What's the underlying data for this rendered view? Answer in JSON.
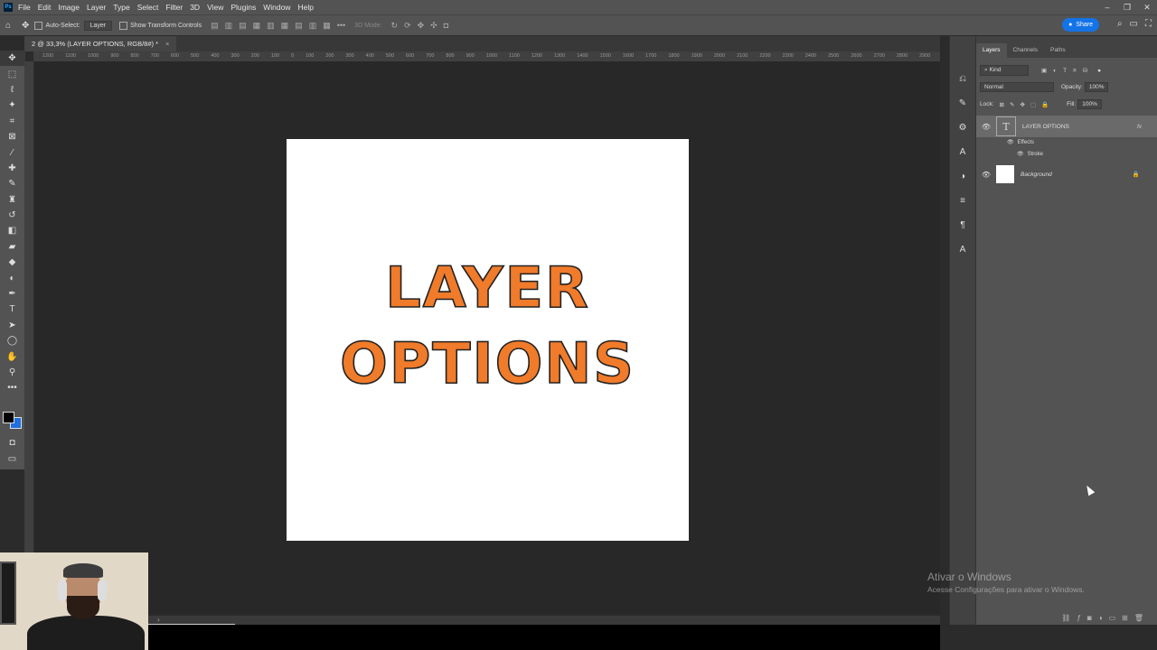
{
  "menubar": {
    "items": [
      "File",
      "Edit",
      "Image",
      "Layer",
      "Type",
      "Select",
      "Filter",
      "3D",
      "View",
      "Plugins",
      "Window",
      "Help"
    ]
  },
  "options_bar": {
    "auto_select_label": "Auto-Select:",
    "auto_select_value": "Layer",
    "transform_label": "Show Transform Controls",
    "mode_3d_label": "3D Mode:",
    "share_label": "Share"
  },
  "document_tab": {
    "title": "2 @ 33,3% (LAYER OPTIONS, RGB/8#) *",
    "close": "×"
  },
  "ruler": {
    "ticks": [
      "1200",
      "1100",
      "1000",
      "900",
      "800",
      "700",
      "600",
      "500",
      "400",
      "300",
      "200",
      "100",
      "0",
      "100",
      "200",
      "300",
      "400",
      "500",
      "600",
      "700",
      "800",
      "900",
      "1000",
      "1100",
      "1200",
      "1300",
      "1400",
      "1500",
      "1600",
      "1700",
      "1800",
      "1900",
      "2000",
      "2100",
      "2200",
      "2300",
      "2400",
      "2500",
      "2600",
      "2700",
      "2800",
      "2900",
      "3000",
      "3100",
      "3200",
      "3300"
    ]
  },
  "canvas": {
    "line1": "LAYER",
    "line2": "OPTIONS",
    "text_fill": "#f07b2a",
    "stroke_color": "#222222"
  },
  "panel": {
    "tabs": [
      "Layers",
      "Channels",
      "Paths"
    ],
    "filter_label": "Kind",
    "blend_mode": "Normal",
    "opacity_label": "Opacity:",
    "opacity_value": "100%",
    "lock_label": "Lock:",
    "fill_label": "Fill:",
    "fill_value": "100%",
    "layers": [
      {
        "name": "LAYER OPTIONS",
        "type": "text",
        "selected": true,
        "fx": "fx"
      },
      {
        "name": "Background",
        "type": "background",
        "selected": false
      }
    ],
    "effects_label": "Effects",
    "stroke_label": "Stroke"
  },
  "watermark": {
    "title": "Ativar o Windows",
    "subtitle": "Acesse Configurações para ativar o Windows."
  },
  "colors": {
    "foreground": "#000000",
    "background_swatch": "#1f6fde",
    "accent": "#1473e6"
  }
}
